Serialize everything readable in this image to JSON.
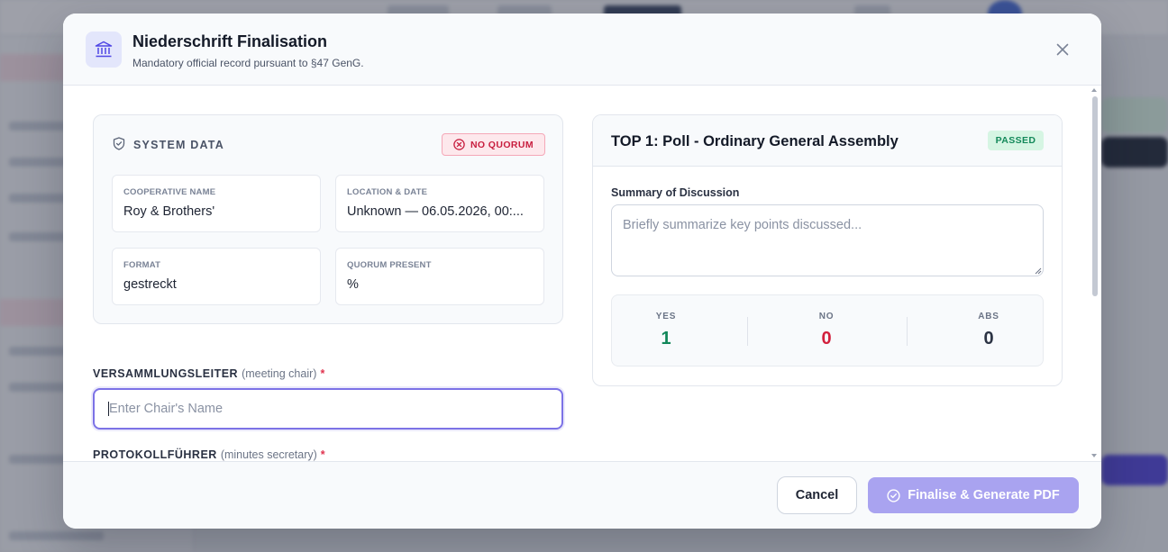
{
  "modal": {
    "title": "Niederschrift Finalisation",
    "subtitle": "Mandatory official record pursuant to §47 GenG.",
    "header_icon": "bank-building-icon",
    "close_icon": "close-icon"
  },
  "system_data": {
    "heading": "SYSTEM DATA",
    "heading_icon": "shield-check-icon",
    "quorum_badge": "NO QUORUM",
    "quorum_badge_icon": "x-circle-icon",
    "fields": [
      {
        "label": "COOPERATIVE NAME",
        "value": "Roy & Brothers'"
      },
      {
        "label": "LOCATION & DATE",
        "value": "Unknown — 06.05.2026, 00:..."
      },
      {
        "label": "FORMAT",
        "value": "gestreckt"
      },
      {
        "label": "QUORUM PRESENT",
        "value": "%"
      }
    ]
  },
  "chair": {
    "label": "VERSAMMLUNGSLEITER",
    "hint": "(meeting chair)",
    "required_mark": "*",
    "value": "",
    "placeholder": "Enter Chair's Name"
  },
  "secretary": {
    "label": "PROTOKOLLFÜHRER",
    "hint": "(minutes secretary)",
    "required_mark": "*",
    "value": ""
  },
  "agenda": {
    "title": "TOP 1: Poll - Ordinary General Assembly",
    "status": "PASSED",
    "summary_label": "Summary of Discussion",
    "summary_value": "",
    "summary_placeholder": "Briefly summarize key points discussed...",
    "votes": [
      {
        "label": "YES",
        "value": "1",
        "color": "#12875a"
      },
      {
        "label": "NO",
        "value": "0",
        "color": "#d21f3c"
      },
      {
        "label": "ABS",
        "value": "0",
        "color": "#2c3344"
      }
    ]
  },
  "footer": {
    "cancel_label": "Cancel",
    "finalise_label": "Finalise & Generate PDF",
    "finalise_icon": "check-circle-icon",
    "finalise_color": "#a9a3f0"
  },
  "colors": {
    "accent": "#7c72e6",
    "danger": "#c81e3f",
    "success": "#14895a"
  }
}
